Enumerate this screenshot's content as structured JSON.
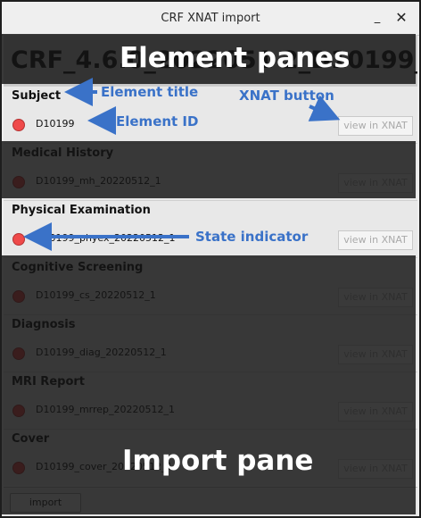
{
  "window": {
    "title": "CRF XNAT import",
    "minimize_glyph": "_",
    "close_glyph": "✕"
  },
  "header": {
    "filename": "CRF_4.6.0_2022051 2_D10199_202205 12_1.tiff"
  },
  "panes": [
    {
      "title": "Subject",
      "id": "D10199",
      "button": "view in XNAT",
      "state_color": "#ef4a4a"
    },
    {
      "title": "Medical History",
      "id": "D10199_mh_20220512_1",
      "button": "view in XNAT",
      "state_color": "#ef4a4a"
    },
    {
      "title": "Physical Examination",
      "id": "D10199_phyex_20220512_1",
      "button": "view in XNAT",
      "state_color": "#ef4a4a"
    },
    {
      "title": "Cognitive Screening",
      "id": "D10199_cs_20220512_1",
      "button": "view in XNAT",
      "state_color": "#ef4a4a"
    },
    {
      "title": "Diagnosis",
      "id": "D10199_diag_20220512_1",
      "button": "view in XNAT",
      "state_color": "#ef4a4a"
    },
    {
      "title": "MRI Report",
      "id": "D10199_mrrep_20220512_1",
      "button": "view in XNAT",
      "state_color": "#ef4a4a"
    },
    {
      "title": "Cover",
      "id": "D10199_cover_20220512_1",
      "button": "view in XNAT",
      "state_color": "#ef4a4a"
    }
  ],
  "import_pane": {
    "button": "import"
  },
  "annotations": {
    "element_panes": "Element panes",
    "element_title": "Element title",
    "element_id": "Element ID",
    "xnat_button": "XNAT button",
    "state_indicator": "State indicator",
    "import_pane": "Import pane",
    "arrow_color": "#3a72c8"
  }
}
